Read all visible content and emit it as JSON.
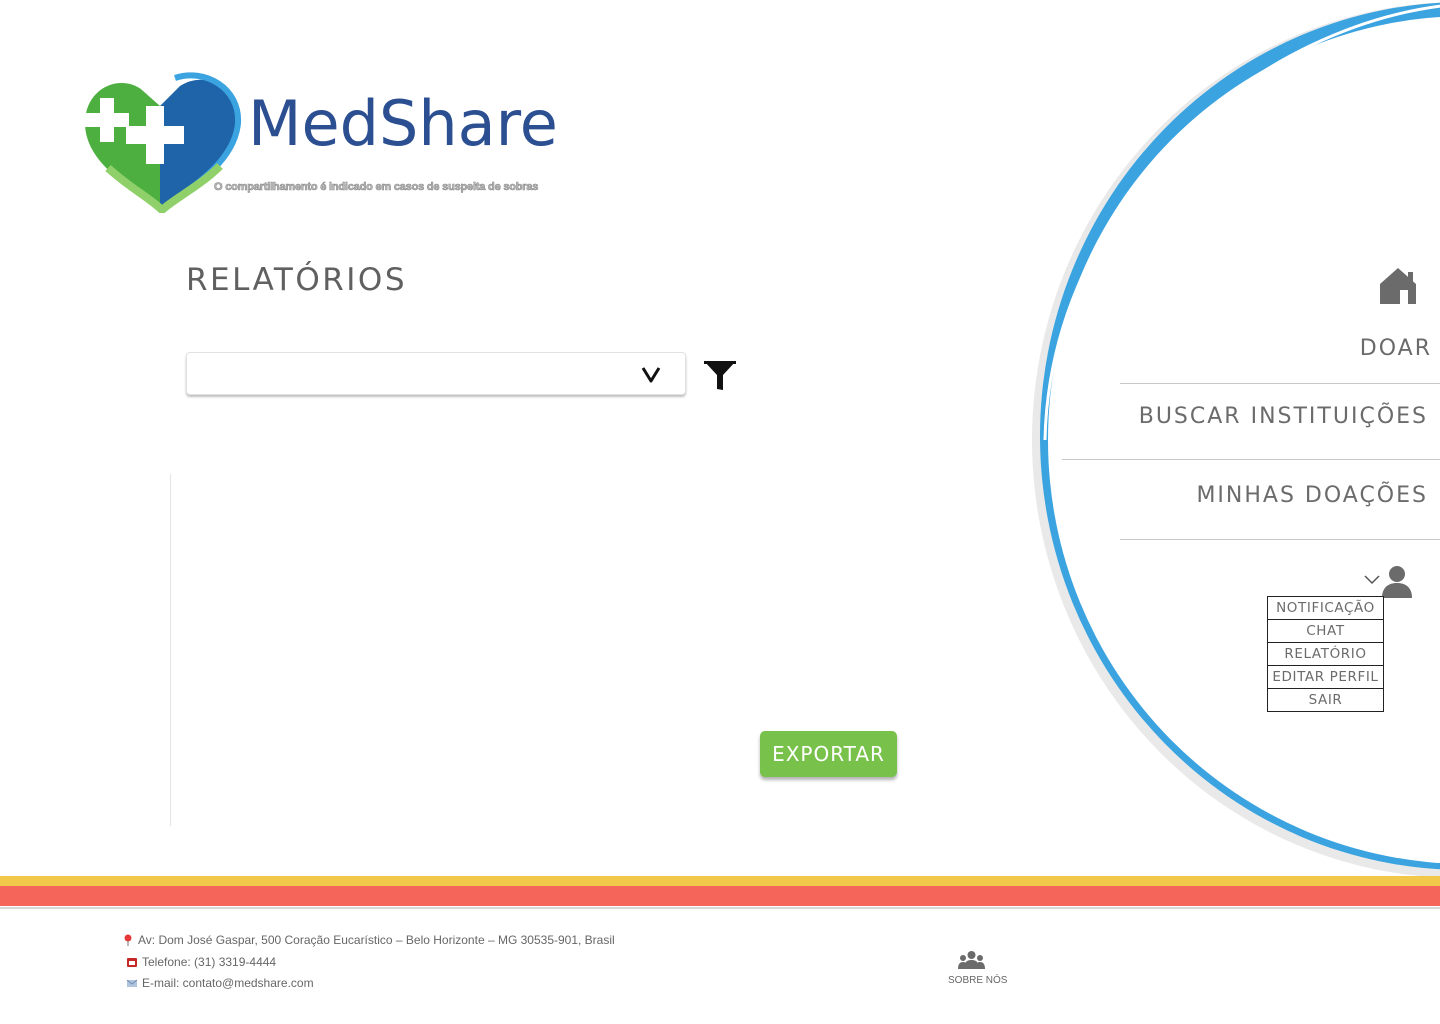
{
  "brand": {
    "name": "MedShare",
    "slogan": "O compartilhamento é indicado em casos de suspeita de sobras"
  },
  "page": {
    "title": "RELATÓRIOS"
  },
  "report": {
    "select_value": "",
    "chevron_glyph": "v",
    "export_label": "EXPORTAR"
  },
  "nav": {
    "items": [
      {
        "label": "DOAR"
      },
      {
        "label": "BUSCAR INSTITUIÇÕES"
      },
      {
        "label": "MINHAS DOAÇÕES"
      }
    ],
    "user_menu": [
      {
        "label": "NOTIFICAÇÃO"
      },
      {
        "label": "CHAT"
      },
      {
        "label": "RELATÓRIO"
      },
      {
        "label": "EDITAR PERFIL"
      },
      {
        "label": "SAIR"
      }
    ]
  },
  "footer": {
    "address": "Av: Dom José Gaspar, 500 Coração Eucarístico – Belo Horizonte – MG 30535-901, Brasil",
    "phone": "Telefone: (31) 3319-4444",
    "email": "E-mail: contato@medshare.com",
    "about": "SOBRE NÓS"
  },
  "colors": {
    "brand_blue": "#2b4f91",
    "brand_green": "#4caf3f",
    "nav_circle": "#3aa3e0",
    "export_green": "#78c14a",
    "stripe_yellow": "#f2c84b",
    "stripe_red": "#f6655a"
  }
}
